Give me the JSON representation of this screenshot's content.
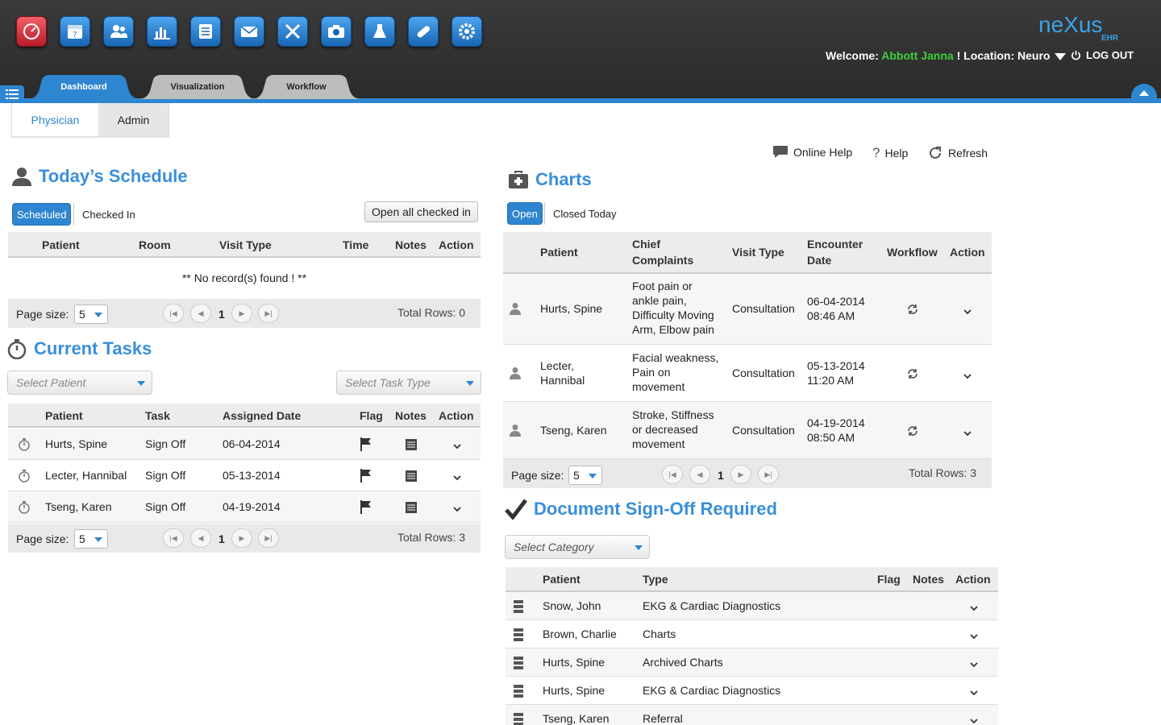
{
  "header": {
    "welcome_label": "Welcome:",
    "user_name": "Abbott Janna",
    "location_label": "! Location: Neuro",
    "logout_label": "LOG OUT",
    "logo_text": "neXus",
    "logo_sub": "EHR"
  },
  "app_icons": [
    "dashboard-gauge-icon",
    "calendar-icon",
    "patients-icon",
    "reports-chart-icon",
    "notes-list-icon",
    "mail-icon",
    "tools-icon",
    "camera-icon",
    "lab-flask-icon",
    "bandage-icon",
    "settings-gear-icon"
  ],
  "tabs": [
    {
      "label": "Dashboard",
      "active": true
    },
    {
      "label": "Visualization",
      "active": false
    },
    {
      "label": "Workflow",
      "active": false
    }
  ],
  "subtabs": [
    {
      "label": "Physician",
      "active": true
    },
    {
      "label": "Admin",
      "active": false
    }
  ],
  "helpbar": {
    "online_help": "Online Help",
    "help": "Help",
    "refresh": "Refresh"
  },
  "schedule": {
    "title": "Today’s Schedule",
    "filter_on": "Scheduled",
    "filter_off": "Checked In",
    "open_all": "Open all checked in",
    "columns": [
      "Patient",
      "Room",
      "Visit Type",
      "Time",
      "Notes",
      "Action"
    ],
    "empty": "** No record(s) found ! **",
    "page_size_label": "Page size:",
    "page_size": "5",
    "page": "1",
    "total_rows": "Total Rows: 0"
  },
  "tasks": {
    "title": "Current Tasks",
    "select_patient": "Select Patient",
    "select_task_type": "Select Task Type",
    "columns": [
      "Patient",
      "Task",
      "Assigned Date",
      "Flag",
      "Notes",
      "Action"
    ],
    "rows": [
      {
        "patient": "Hurts, Spine",
        "task": "Sign Off",
        "date": "06-04-2014"
      },
      {
        "patient": "Lecter, Hannibal",
        "task": "Sign Off",
        "date": "05-13-2014"
      },
      {
        "patient": "Tseng, Karen",
        "task": "Sign Off",
        "date": "04-19-2014"
      }
    ],
    "page_size_label": "Page size:",
    "page_size": "5",
    "page": "1",
    "total_rows": "Total Rows: 3"
  },
  "charts": {
    "title": "Charts",
    "filter_on": "Open",
    "filter_off": "Closed Today",
    "columns": {
      "patient": "Patient",
      "chief1": "Chief",
      "chief2": "Complaints",
      "visit": "Visit Type",
      "enc1": "Encounter",
      "enc2": "Date",
      "workflow": "Workflow",
      "action": "Action"
    },
    "rows": [
      {
        "patient1": "Hurts, Spine",
        "patient2": "",
        "complaints": [
          "Foot pain or",
          "ankle pain,",
          "Difficulty Moving",
          "Arm, Elbow pain"
        ],
        "visit": "Consultation",
        "date": "06-04-2014",
        "time": "08:46 AM"
      },
      {
        "patient1": "Lecter,",
        "patient2": "Hannibal",
        "complaints": [
          "Facial weakness,",
          "Pain on",
          "movement"
        ],
        "visit": "Consultation",
        "date": "05-13-2014",
        "time": "11:20 AM"
      },
      {
        "patient1": "Tseng, Karen",
        "patient2": "",
        "complaints": [
          "Stroke, Stiffness",
          "or decreased",
          "movement"
        ],
        "visit": "Consultation",
        "date": "04-19-2014",
        "time": "08:50 AM"
      }
    ],
    "page_size_label": "Page size:",
    "page_size": "5",
    "page": "1",
    "total_rows": "Total Rows: 3"
  },
  "signoff": {
    "title": "Document Sign-Off Required",
    "select_category": "Select Category",
    "columns": [
      "Patient",
      "Type",
      "Flag",
      "Notes",
      "Action"
    ],
    "rows": [
      {
        "patient": "Snow, John",
        "type": "EKG & Cardiac Diagnostics"
      },
      {
        "patient": "Brown, Charlie",
        "type": "Charts"
      },
      {
        "patient": "Hurts, Spine",
        "type": "Archived Charts"
      },
      {
        "patient": "Hurts, Spine",
        "type": "EKG & Cardiac Diagnostics"
      },
      {
        "patient": "Tseng, Karen",
        "type": "Referral"
      }
    ]
  },
  "colors": {
    "accent": "#2f86d0",
    "title": "#3a8fd9",
    "user": "#3cd13c",
    "topbar": "#2f2f2f"
  }
}
